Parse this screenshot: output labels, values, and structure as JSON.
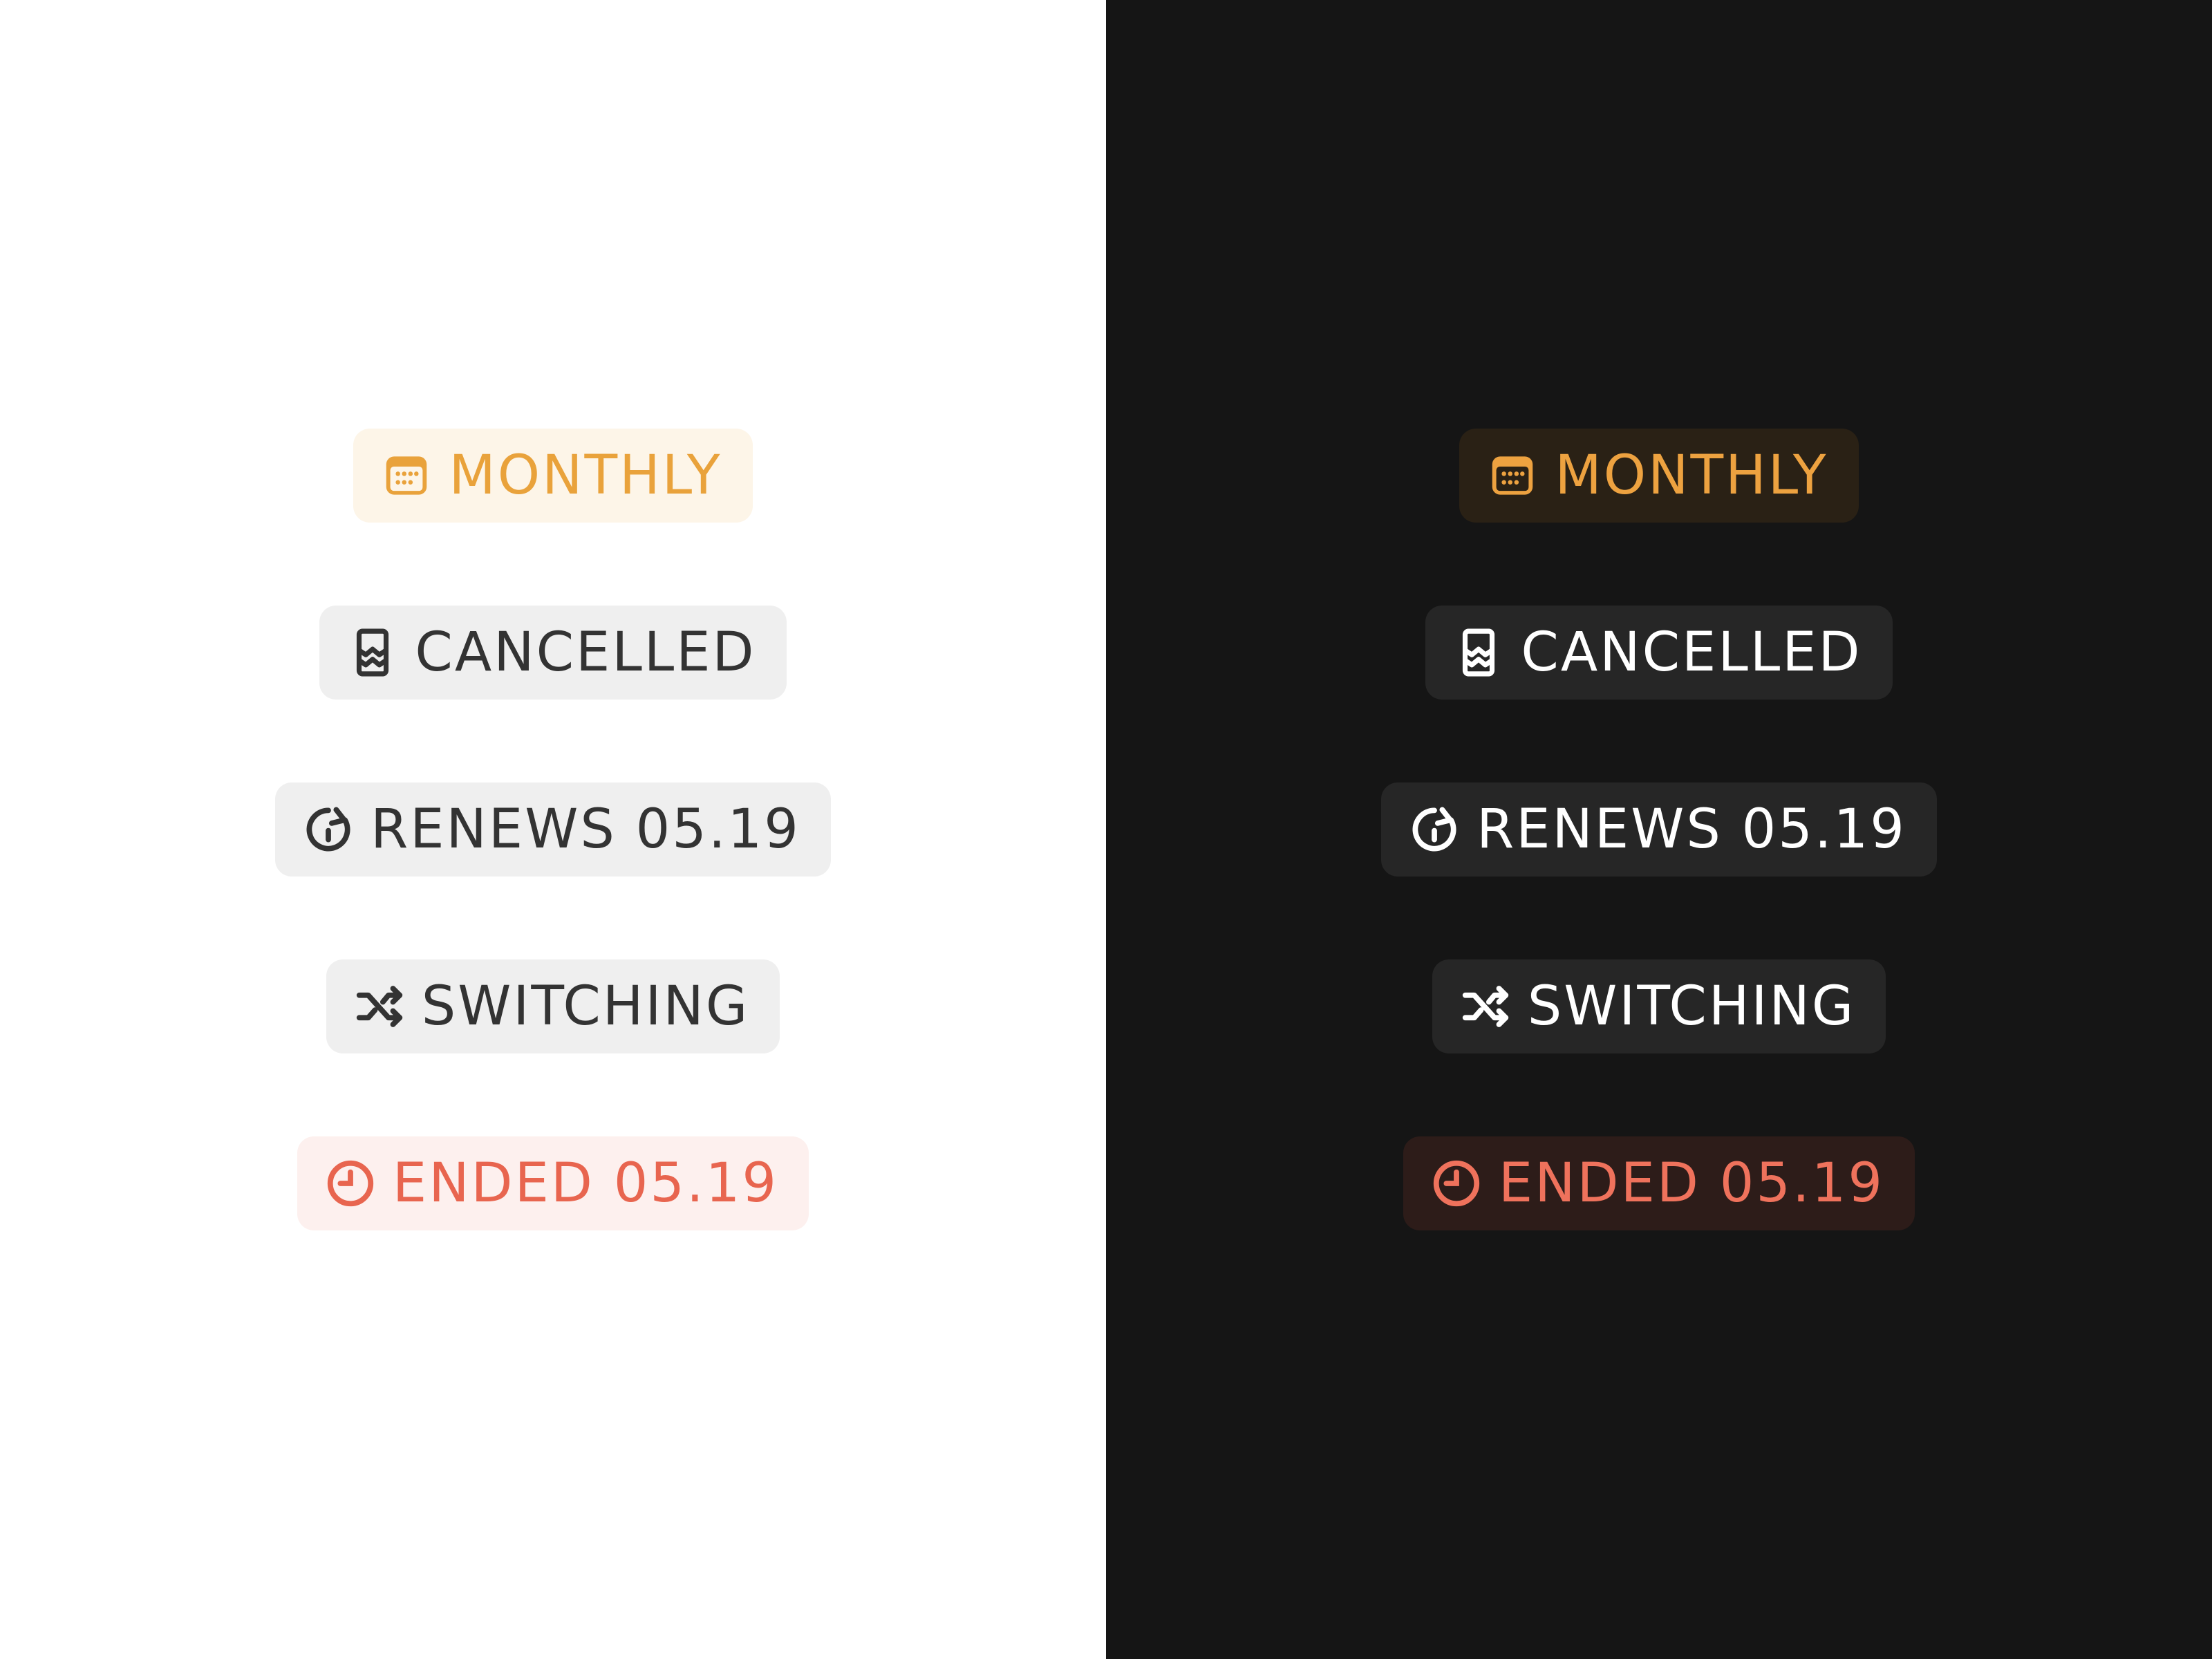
{
  "colors": {
    "light_background": "#ffffff",
    "dark_background": "#151515",
    "accent_orange": "#e9a23b",
    "accent_red": "#e8654f"
  },
  "panels": [
    {
      "theme": "light",
      "badges": [
        {
          "icon": "calendar-icon",
          "label": "MONTHLY"
        },
        {
          "icon": "cancelled-ticket-icon",
          "label": "CANCELLED"
        },
        {
          "icon": "renew-arrow-icon",
          "label": "RENEWS 05.19"
        },
        {
          "icon": "shuffle-icon",
          "label": "SWITCHING"
        },
        {
          "icon": "clock-icon",
          "label": "ENDED 05.19"
        }
      ]
    },
    {
      "theme": "dark",
      "badges": [
        {
          "icon": "calendar-icon",
          "label": "MONTHLY"
        },
        {
          "icon": "cancelled-ticket-icon",
          "label": "CANCELLED"
        },
        {
          "icon": "renew-arrow-icon",
          "label": "RENEWS 05.19"
        },
        {
          "icon": "shuffle-icon",
          "label": "SWITCHING"
        },
        {
          "icon": "clock-icon",
          "label": "ENDED 05.19"
        }
      ]
    }
  ]
}
